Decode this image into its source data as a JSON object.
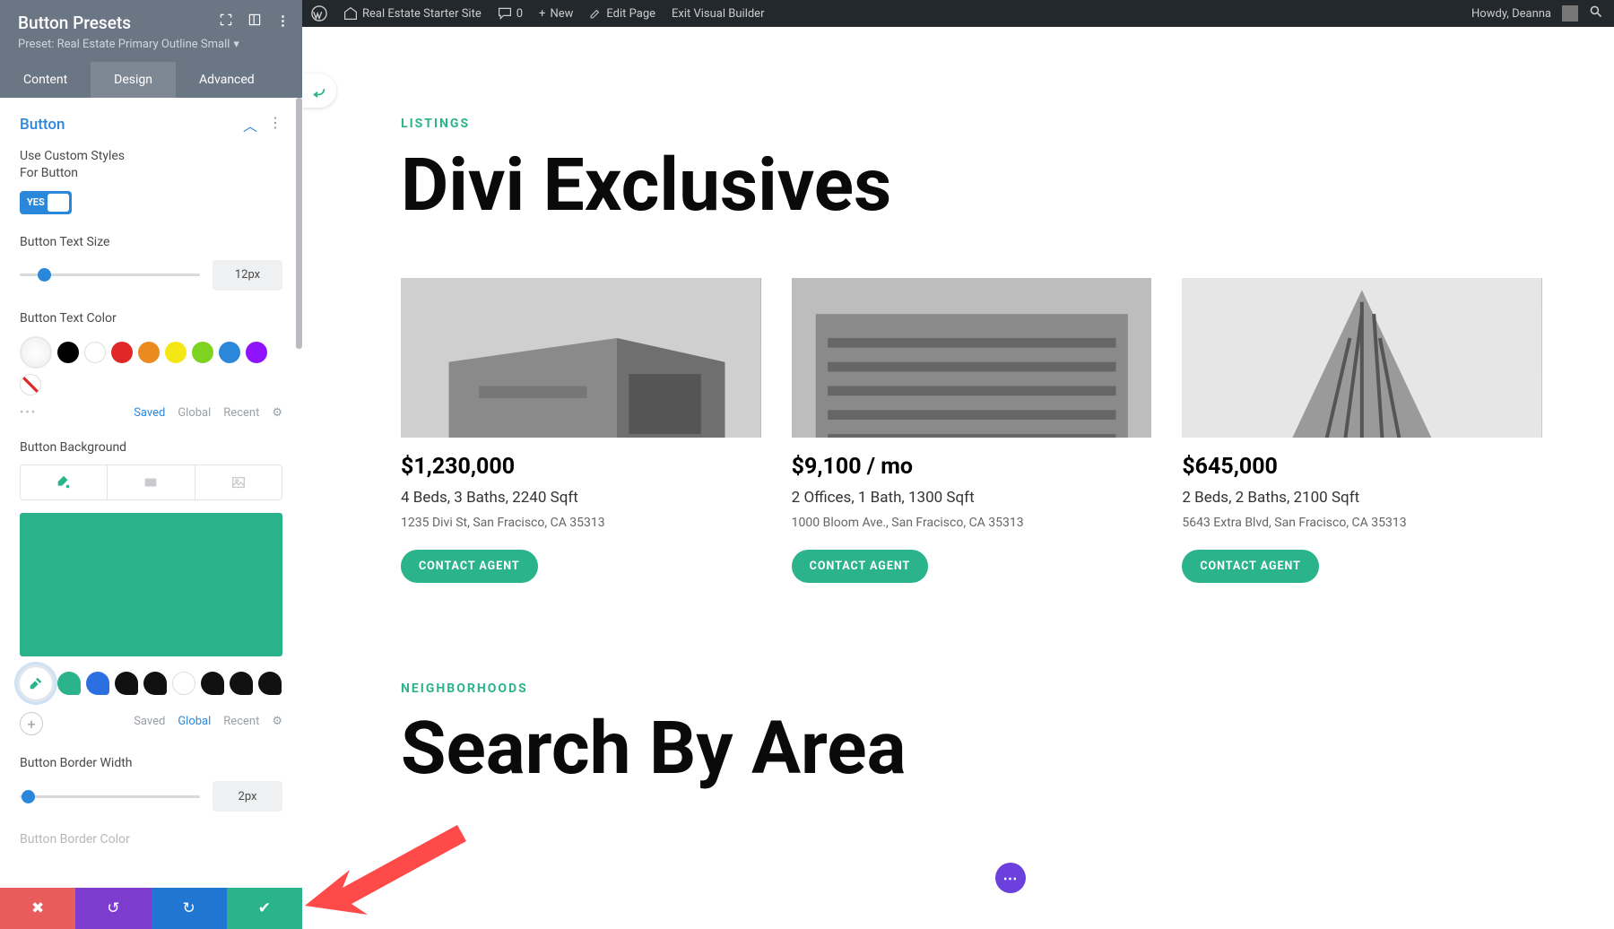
{
  "wp_bar": {
    "site": "Real Estate Starter Site",
    "comments": "0",
    "new": "New",
    "edit": "Edit Page",
    "exit": "Exit Visual Builder",
    "howdy": "Howdy, Deanna"
  },
  "sidebar": {
    "title": "Button Presets",
    "preset": "Preset: Real Estate Primary Outline Small",
    "tabs": {
      "content": "Content",
      "design": "Design",
      "advanced": "Advanced"
    },
    "section": "Button",
    "custom_styles_label": "Use Custom Styles For Button",
    "toggle_yes": "YES",
    "text_size_label": "Button Text Size",
    "text_size_value": "12px",
    "text_color_label": "Button Text Color",
    "palette_meta": {
      "saved": "Saved",
      "global": "Global",
      "recent": "Recent"
    },
    "bg_label": "Button Background",
    "border_label": "Button Border Width",
    "border_value": "2px",
    "border_color_label_partial": "Button Border Color",
    "text_swatches": [
      "#000000",
      "#ffffff",
      "#e02828",
      "#ea8a1f",
      "#f5e615",
      "#7ed321",
      "#2b87da",
      "#9013fe"
    ],
    "global_swatches": [
      "#2bb48c",
      "#2b6fe0",
      "#111111",
      "#111111",
      "#ffffff",
      "#111111",
      "#111111",
      "#111111"
    ]
  },
  "main": {
    "eyebrow1": "LISTINGS",
    "h1": "Divi Exclusives",
    "eyebrow2": "NEIGHBORHOODS",
    "h2": "Search By Area",
    "cta": "CONTACT AGENT",
    "cards": [
      {
        "price": "$1,230,000",
        "specs": "4 Beds, 3 Baths, 2240 Sqft",
        "addr": "1235 Divi St, San Fracisco, CA 35313"
      },
      {
        "price": "$9,100 / mo",
        "specs": "2 Offices, 1 Bath, 1300 Sqft",
        "addr": "1000 Bloom Ave., San Fracisco, CA 35313"
      },
      {
        "price": "$645,000",
        "specs": "2 Beds, 2 Baths, 2100 Sqft",
        "addr": "5643 Extra Blvd, San Fracisco, CA 35313"
      }
    ]
  }
}
